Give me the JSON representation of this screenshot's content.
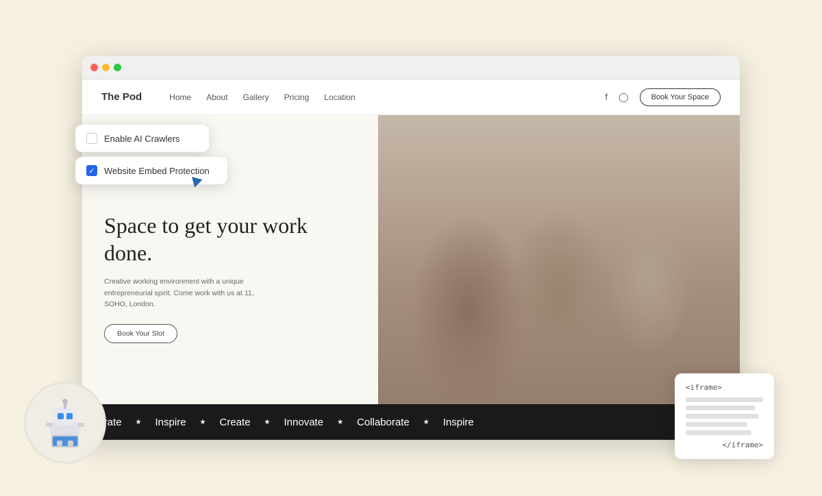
{
  "background_color": "#f5f0e0",
  "browser": {
    "dots": [
      "#ff5f57",
      "#febc2e",
      "#28c840"
    ]
  },
  "site": {
    "logo": "The Pod",
    "nav_links": [
      "Home",
      "About",
      "Gallery",
      "Pricing",
      "Location"
    ],
    "book_button": "Book Your Space",
    "hero_title": "Space to get your work done.",
    "hero_subtitle": "Creative working environment with a unique entrepreneurial spirit. Come work with us at 11, SOHO, London.",
    "hero_cta": "Book Your Slot",
    "ticker_items": [
      "llaborate",
      "Inspire",
      "Create",
      "Innovate",
      "Collaborate",
      "Inspire"
    ]
  },
  "panels": {
    "enable_crawlers": {
      "label": "Enable AI Crawlers",
      "checked": false
    },
    "website_embed": {
      "label": "Website Embed Protection",
      "checked": true
    }
  },
  "iframe_panel": {
    "open_tag": "<iframe>",
    "close_tag": "</iframe>",
    "lines": [
      1,
      2,
      3,
      4,
      5
    ]
  }
}
